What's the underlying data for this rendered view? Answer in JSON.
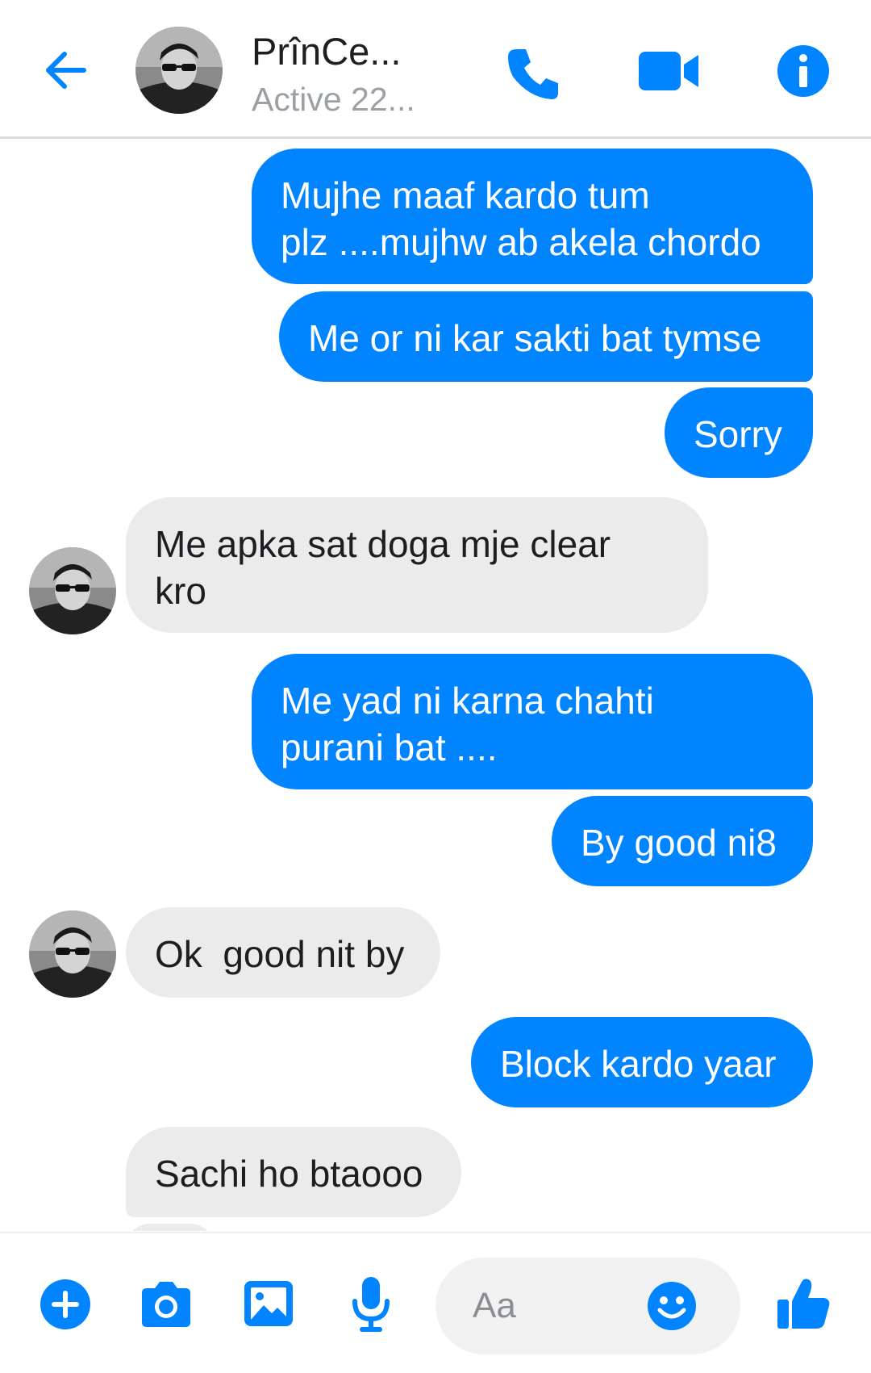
{
  "header": {
    "name": "PrînCe...",
    "status": "Active 22..."
  },
  "messages": [
    {
      "dir": "out",
      "text": "Mujhe maaf kardo tum\nplz ....mujhw ab akela chordo"
    },
    {
      "dir": "out",
      "text": "Me or ni kar sakti bat tymse"
    },
    {
      "dir": "out",
      "text": "Sorry"
    },
    {
      "dir": "in",
      "text": "Me apka sat doga mje clear\nkro"
    },
    {
      "dir": "out",
      "text": "Me yad ni karna chahti\npurani bat ...."
    },
    {
      "dir": "out",
      "text": "By good ni8"
    },
    {
      "dir": "in",
      "text": "Ok  good nit by"
    },
    {
      "dir": "out",
      "text": "Block kardo yaar"
    },
    {
      "dir": "in",
      "text": "Sachi ho btaooo"
    }
  ],
  "composer": {
    "placeholder": "Aa"
  },
  "colors": {
    "accent": "#0084ff",
    "incoming_bubble": "#ebebeb"
  },
  "icons": {
    "back": "back-arrow-icon",
    "call": "phone-icon",
    "video": "video-camera-icon",
    "info": "info-icon",
    "plus": "plus-icon",
    "camera": "camera-icon",
    "gallery": "image-icon",
    "mic": "microphone-icon",
    "emoji": "emoji-icon",
    "like": "thumbs-up-icon"
  }
}
